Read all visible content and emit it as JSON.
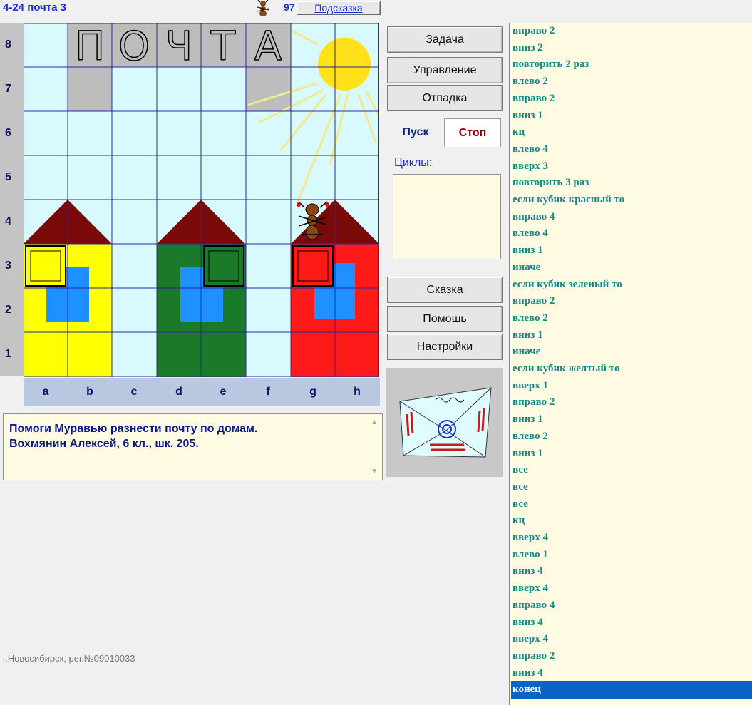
{
  "header": {
    "level_title": "4-24 почта 3",
    "score": "97",
    "hint_button": "Подсказка"
  },
  "board": {
    "row_labels": [
      "8",
      "7",
      "6",
      "5",
      "4",
      "3",
      "2",
      "1"
    ],
    "col_labels": [
      "a",
      "b",
      "c",
      "d",
      "e",
      "f",
      "g",
      "h"
    ],
    "letters": [
      "П",
      "О",
      "Ч",
      "Т",
      "А"
    ],
    "colors": {
      "sky": "#d8faff",
      "grid": "#2a2a9a",
      "gray_cell": "#bdbdbd",
      "sun": "#ffe21a",
      "roof": "#7a0a0a",
      "house_yellow": "#ffff00",
      "house_green": "#1a7a2a",
      "house_red": "#ff1a1a",
      "window": "#1e90ff"
    }
  },
  "buttons": {
    "task": "Задача",
    "control": "Управление",
    "debug": "Отпадка",
    "run": "Пуск",
    "stop": "Стоп",
    "cycles_label": "Циклы:",
    "story": "Сказка",
    "help": "Помошь",
    "settings": "Настройки"
  },
  "description": {
    "line1": "Помоги Муравью разнести почту по домам.",
    "line2": "Вохмянин Алексей, 6 кл., шк. 205."
  },
  "footer": "г.Новосибирск, рег.№09010033",
  "program": {
    "selected_index": 39,
    "lines": [
      "вправо 2",
      "вниз 2",
      "повторить 2 раз",
      "влево 2",
      "вправо 2",
      "вниз 1",
      "кц",
      "влево 4",
      "вверх 3",
      "повторить 3 раз",
      "если кубик красный то",
      "вправо 4",
      "влево 4",
      "вниз 1",
      "иначе",
      "если кубик зеленый то",
      "вправо 2",
      "влево 2",
      "вниз 1",
      "иначе",
      "если кубик желтый то",
      "вверх 1",
      "вправо 2",
      "вниз 1",
      "влево 2",
      "вниз 1",
      "все",
      "все",
      "все",
      "кц",
      "вверх 4",
      "влево 1",
      "вниз 4",
      "вверх 4",
      "вправо 4",
      "вниз 4",
      "вверх 4",
      "вправо 2",
      "вниз 4",
      "конец"
    ]
  }
}
